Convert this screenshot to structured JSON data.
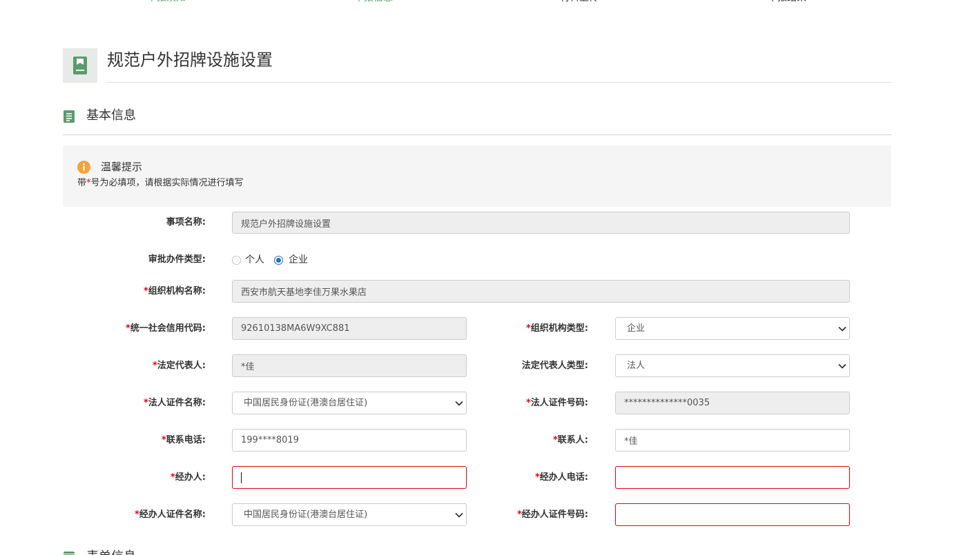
{
  "steps": [
    {
      "label": "申报须知",
      "active": true
    },
    {
      "label": "申报信息",
      "active": true
    },
    {
      "label": "材料上传",
      "active": false
    },
    {
      "label": "申报结果",
      "active": false
    }
  ],
  "header": {
    "title": "规范户外招牌设施设置",
    "icon": "document-icon"
  },
  "section_basic": {
    "title": "基本信息",
    "icon": "list-icon"
  },
  "tip": {
    "icon": "info-icon",
    "title": "温馨提示",
    "prefix": "带",
    "mark": "*",
    "suffix": "号为必填项，请根据实际情况进行填写"
  },
  "form": {
    "required_mark": "*",
    "item_name": {
      "label": "事项名称:",
      "value": "规范户外招牌设施设置"
    },
    "apply_type": {
      "label": "审批办件类型:",
      "options": [
        {
          "label": "个人",
          "checked": false
        },
        {
          "label": "企业",
          "checked": true
        }
      ]
    },
    "org_name": {
      "label": "组织机构名称:",
      "value": "西安市航天基地李佳万果水果店"
    },
    "credit_code": {
      "label": "统一社会信用代码:",
      "value": "92610138MA6W9XC881"
    },
    "org_type": {
      "label": "组织机构类型:",
      "value": "企业"
    },
    "legal_rep": {
      "label": "法定代表人:",
      "value": "*佳"
    },
    "legal_rep_type": {
      "label": "法定代表人类型:",
      "value": "法人"
    },
    "legal_id_type": {
      "label": "法人证件名称:",
      "value": "中国居民身份证(港澳台居住证)"
    },
    "legal_id_no": {
      "label": "法人证件号码:",
      "value": "**************0035"
    },
    "contact_phone": {
      "label": "联系电话:",
      "value": "199****8019"
    },
    "contact_person": {
      "label": "联系人:",
      "value": "*佳"
    },
    "handler": {
      "label": "经办人:",
      "value": ""
    },
    "handler_phone": {
      "label": "经办人电话:",
      "value": ""
    },
    "handler_id_type": {
      "label": "经办人证件名称:",
      "value": "中国居民身份证(港澳台居住证)"
    },
    "handler_id_no": {
      "label": "经办人证件号码:",
      "value": ""
    }
  },
  "next_section": {
    "title": "表单信息",
    "icon": "list-icon"
  },
  "colors": {
    "accent": "#5b9a6c",
    "required": "#e60012",
    "error": "#e60012",
    "info": "#f6a23a",
    "radio": "#1e6fd9"
  }
}
